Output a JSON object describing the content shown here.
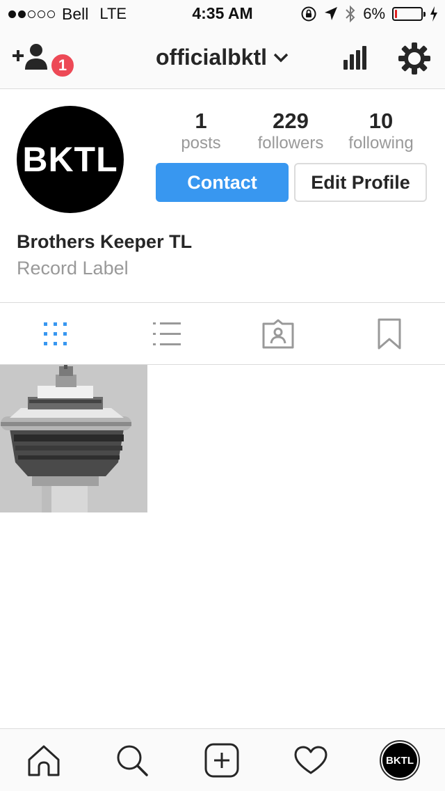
{
  "status_bar": {
    "carrier": "Bell",
    "network": "LTE",
    "time": "4:35 AM",
    "battery_percent": "6%",
    "battery_level": 0.06,
    "signal_bars_filled": 2,
    "signal_bars_total": 5
  },
  "header": {
    "username": "officialbktl",
    "notification_count": "1",
    "icons": [
      "add-user-icon",
      "chevron-down-icon",
      "insights-icon",
      "gear-icon"
    ]
  },
  "profile": {
    "avatar_text": "BKTL",
    "stats": [
      {
        "value": "1",
        "label": "posts"
      },
      {
        "value": "229",
        "label": "followers"
      },
      {
        "value": "10",
        "label": "following"
      }
    ],
    "contact_label": "Contact",
    "edit_label": "Edit Profile",
    "full_name": "Brothers Keeper TL",
    "category": "Record Label"
  },
  "tabs": {
    "items": [
      "grid-icon",
      "list-icon",
      "tagged-icon",
      "saved-icon"
    ],
    "active": "grid-icon"
  },
  "bottom_nav": {
    "items": [
      "home-icon",
      "search-icon",
      "add-post-icon",
      "heart-icon",
      "profile-avatar"
    ],
    "avatar_text": "BKTL"
  },
  "colors": {
    "accent": "#3897f0",
    "badge": "#ed4956",
    "battery_low": "#e02020"
  }
}
